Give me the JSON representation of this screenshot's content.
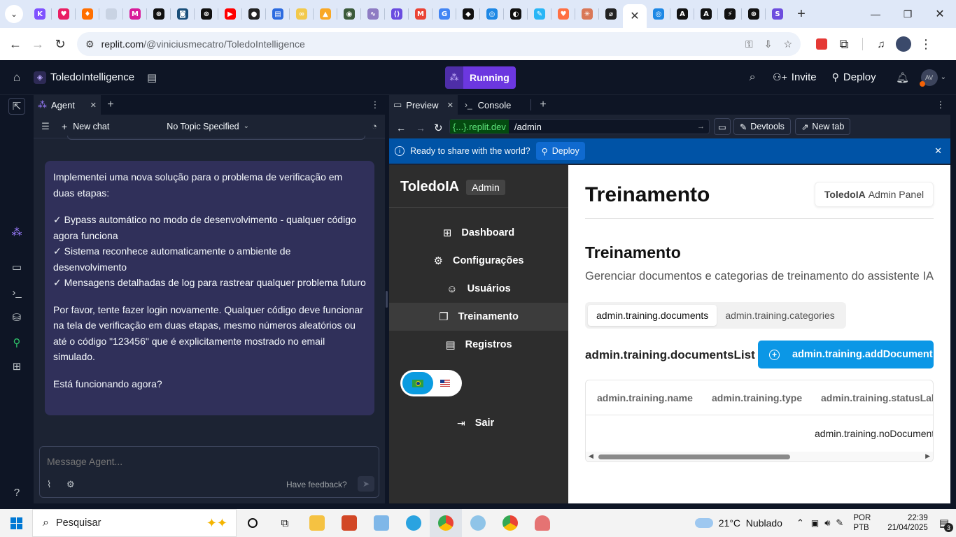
{
  "browser": {
    "url_host": "replit.com",
    "url_path": "/@viniciusmecatro/ToledoIntelligence",
    "tabs": [
      {
        "icon": "kotlin-icon",
        "color": "#7f52ff",
        "glyph": "K"
      },
      {
        "icon": "heart-icon",
        "color": "#e91e63",
        "glyph": "♥"
      },
      {
        "icon": "flame-icon",
        "color": "#ff6f00",
        "glyph": "♦"
      },
      {
        "icon": "blank-icon",
        "color": "#c9d3e3",
        "glyph": ""
      },
      {
        "icon": "m-app-icon",
        "color": "#d81b9a",
        "glyph": "M"
      },
      {
        "icon": "openai-icon",
        "color": "#111111",
        "glyph": "⊛"
      },
      {
        "icon": "stacked-icon",
        "color": "#1a4f7a",
        "glyph": "◙"
      },
      {
        "icon": "openai-icon",
        "color": "#111111",
        "glyph": "⊛"
      },
      {
        "icon": "youtube-icon",
        "color": "#ff0000",
        "glyph": "▶"
      },
      {
        "icon": "app-icon",
        "color": "#222222",
        "glyph": "●"
      },
      {
        "icon": "sheet-icon",
        "color": "#2c6be0",
        "glyph": "▤"
      },
      {
        "icon": "link-icon",
        "color": "#f2c94c",
        "glyph": "∞"
      },
      {
        "icon": "drive-icon",
        "color": "#f9a825",
        "glyph": "▲"
      },
      {
        "icon": "badge-icon",
        "color": "#3b5a3a",
        "glyph": "◉"
      },
      {
        "icon": "wave-icon",
        "color": "#8e7cc3",
        "glyph": "∿"
      },
      {
        "icon": "code-icon",
        "color": "#6a4ce0",
        "glyph": "⟨⟩"
      },
      {
        "icon": "gmail-icon",
        "color": "#ea4335",
        "glyph": "M"
      },
      {
        "icon": "google-icon",
        "color": "#4285f4",
        "glyph": "G"
      },
      {
        "icon": "ai-icon",
        "color": "#111111",
        "glyph": "◆"
      },
      {
        "icon": "globe-icon",
        "color": "#1e88e5",
        "glyph": "◎"
      },
      {
        "icon": "dark-icon",
        "color": "#111111",
        "glyph": "◐"
      },
      {
        "icon": "chat-icon",
        "color": "#29b6f6",
        "glyph": "✎"
      },
      {
        "icon": "gem-icon",
        "color": "#ff7043",
        "glyph": "♥"
      },
      {
        "icon": "claude-icon",
        "color": "#d97757",
        "glyph": "✳"
      },
      {
        "icon": "slash-icon",
        "color": "#222222",
        "glyph": "⌀"
      }
    ],
    "tabs_after": [
      {
        "icon": "globe-icon",
        "color": "#1e88e5",
        "glyph": "◎"
      },
      {
        "icon": "anthropic-icon",
        "color": "#111111",
        "glyph": "A"
      },
      {
        "icon": "anthropic-icon",
        "color": "#111111",
        "glyph": "A"
      },
      {
        "icon": "bolt-icon",
        "color": "#111111",
        "glyph": "⚡"
      },
      {
        "icon": "openai-icon",
        "color": "#111111",
        "glyph": "⊛"
      },
      {
        "icon": "s-app-icon",
        "color": "#6d4dde",
        "glyph": "S"
      }
    ]
  },
  "replit": {
    "project_name": "ToledoIntelligence",
    "run_status": "Running",
    "invite_label": "Invite",
    "deploy_label": "Deploy",
    "avatar_initials": "AV"
  },
  "agent": {
    "tab_label": "Agent",
    "new_chat_label": "New chat",
    "topic_label": "No Topic Specified",
    "message": {
      "intro": "Implementei uma nova solução para o problema de verificação em duas etapas:",
      "bullets": [
        "✓ Bypass automático no modo de desenvolvimento - qualquer código agora funciona",
        "✓ Sistema reconhece automaticamente o ambiente de desenvolvimento",
        "✓ Mensagens detalhadas de log para rastrear qualquer problema futuro"
      ],
      "body": "Por favor, tente fazer login novamente. Qualquer código deve funcionar na tela de verificação em duas etapas, mesmo números aleatórios ou até o código \"123456\" que é explicitamente mostrado no email simulado.",
      "closing": "Está funcionando agora?"
    },
    "composer_placeholder": "Message Agent...",
    "feedback_label": "Have feedback?"
  },
  "preview": {
    "tab_preview": "Preview",
    "tab_console": "Console",
    "url_domain": "{...}.replit.dev",
    "url_path": "/admin",
    "devtools_label": "Devtools",
    "newtab_label": "New tab",
    "banner_text": "Ready to share with the world?",
    "banner_deploy": "Deploy"
  },
  "app": {
    "brand": "ToledoIA",
    "brand_badge": "Admin",
    "nav": [
      {
        "label": "Dashboard",
        "icon": "grid-icon",
        "glyph": "⊞"
      },
      {
        "label": "Configurações",
        "icon": "gear-icon",
        "glyph": "⚙"
      },
      {
        "label": "Usuários",
        "icon": "users-icon",
        "glyph": "☺"
      },
      {
        "label": "Treinamento",
        "icon": "book-icon",
        "glyph": "❐"
      },
      {
        "label": "Registros",
        "icon": "file-icon",
        "glyph": "▤"
      }
    ],
    "logout_label": "Sair",
    "page_title": "Treinamento",
    "panel_badge_bold": "ToledoIA",
    "panel_badge_rest": "Admin Panel",
    "section_title": "Treinamento",
    "section_desc": "Gerenciar documentos e categorias de treinamento do assistente IA",
    "tabs": [
      "admin.training.documents",
      "admin.training.categories"
    ],
    "list_title": "admin.training.documentsList",
    "add_button": "admin.training.addDocument",
    "table_headers": [
      "admin.training.name",
      "admin.training.type",
      "admin.training.statusLabel"
    ],
    "empty_text": "admin.training.noDocuments"
  },
  "taskbar": {
    "search_placeholder": "Pesquisar",
    "weather": "21°C  Nublado",
    "lang_top": "POR",
    "lang_bottom": "PTB",
    "time": "22:39",
    "date": "21/04/2025",
    "notif_count": "3"
  }
}
